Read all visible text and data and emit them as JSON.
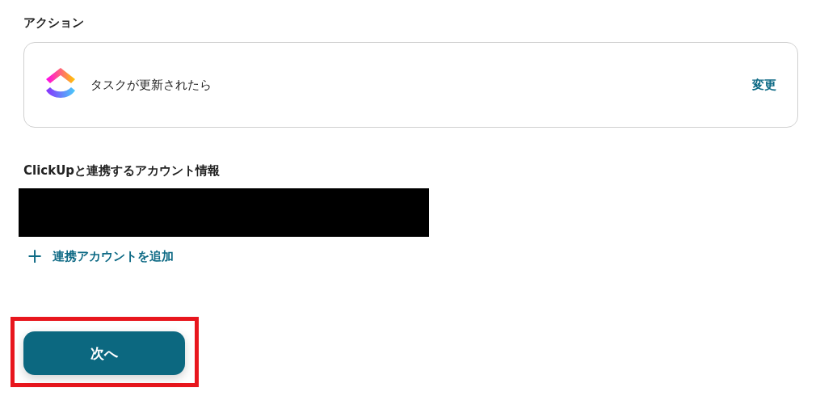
{
  "action_section": {
    "title": "アクション",
    "trigger": {
      "label": "タスクが更新されたら",
      "change_link": "変更"
    }
  },
  "account_section": {
    "title": "ClickUpと連携するアカウント情報",
    "redacted": true,
    "add_link": {
      "icon": "+",
      "label": "連携アカウントを追加"
    }
  },
  "next_button": {
    "label": "次へ",
    "highlighted": true
  }
}
